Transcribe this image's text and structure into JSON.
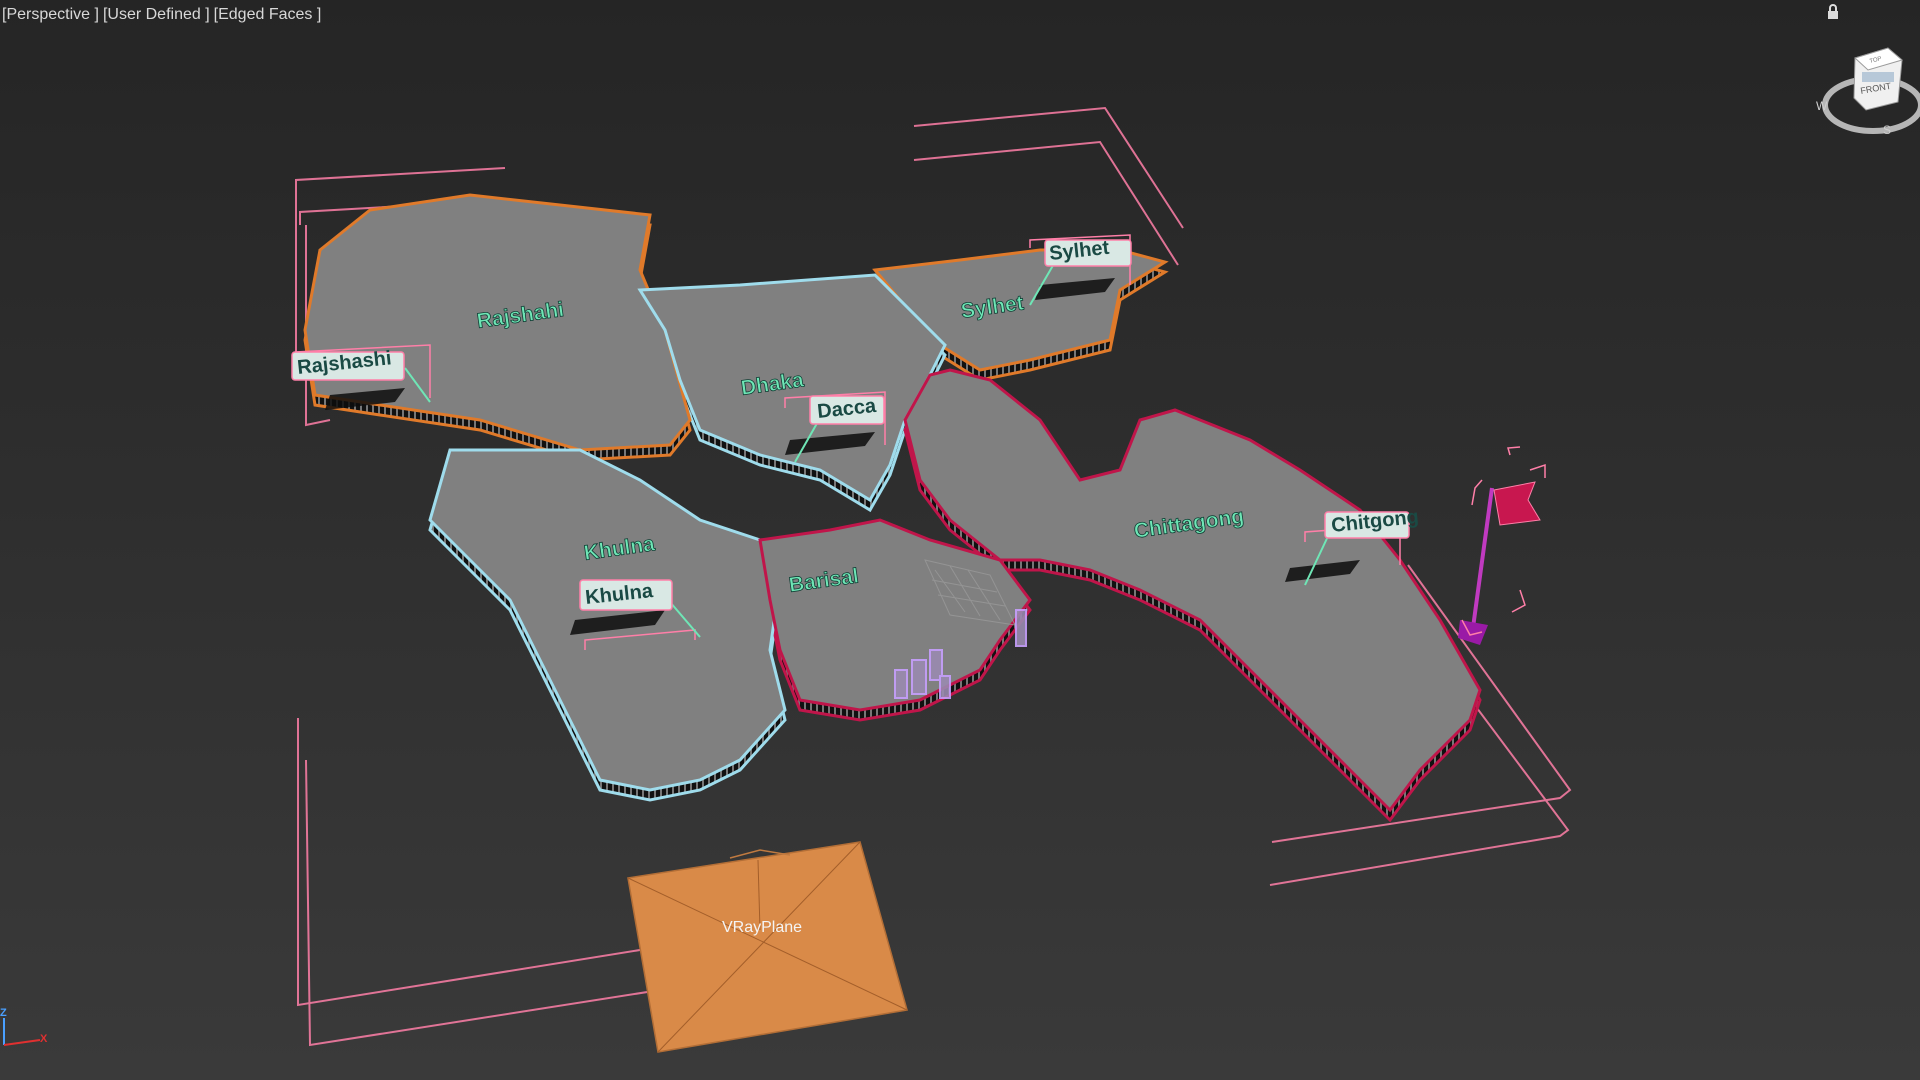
{
  "viewport": {
    "labels": [
      "[Perspective ]",
      "[User Defined ]",
      "[Edged Faces ]"
    ]
  },
  "view_cube": {
    "face_label": "FRONT",
    "top_label": "TOP",
    "compass_letters": [
      "W",
      "S"
    ]
  },
  "map": {
    "division_labels": [
      "Rajshahi",
      "Dhaka",
      "Sylhet",
      "Khulna",
      "Barisal",
      "Chittagong"
    ],
    "city_tags": [
      "Rajshashi",
      "Dacca",
      "Sylhet",
      "Khulna",
      "Chitgong"
    ]
  },
  "objects": {
    "plane_label": "VRayPlane"
  },
  "axis_tripod": {
    "z_label": "Z",
    "x_label": "X"
  },
  "colors": {
    "background_top": "#252525",
    "background_bottom": "#3a3a3a",
    "land": "#808080",
    "rajshahi_sylhet_edge": "#e07a2a",
    "dhaka_khulna_edge": "#9fdcec",
    "barisal_chittagong_edge": "#c0154a",
    "selection_bracket": "#ff7fa8",
    "label_text": "#6fe6b6",
    "vray_plane": "#d98a48"
  }
}
